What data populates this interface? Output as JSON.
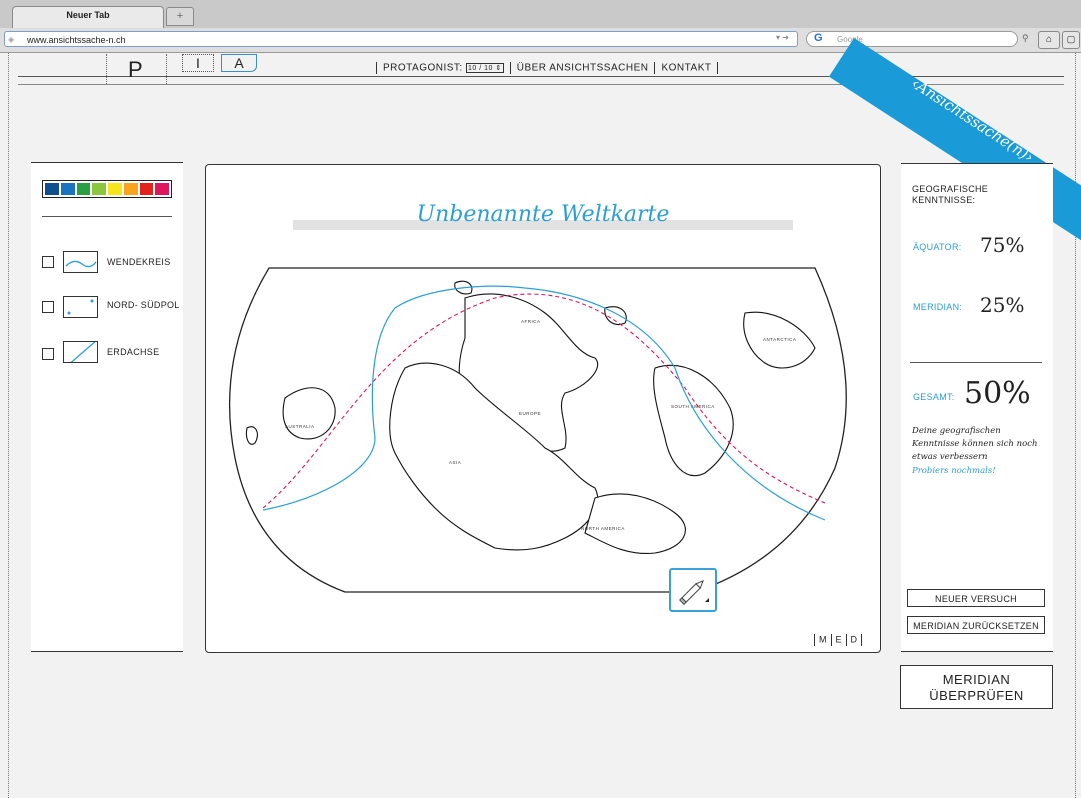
{
  "browser": {
    "tab_title": "Neuer Tab",
    "new_tab_label": "+",
    "url": "www.ansichtssache-n.ch",
    "search_placeholder": "Google",
    "search_engine_glyph": "G"
  },
  "header": {
    "logo_p": "P",
    "logo_i": "I",
    "logo_a": "A",
    "nav": {
      "protagonist_label": "PROTAGONIST:",
      "protagonist_value": "10 / 10",
      "about_label": "ÜBER ANSICHTSSACHEN",
      "contact_label": "KONTAKT"
    },
    "banner_text": "‹Ansichtssache(n)›",
    "banner_color": "#1a9ad6"
  },
  "left_panel": {
    "palette": [
      "#0d4f91",
      "#1a73c0",
      "#2aa043",
      "#8cc63f",
      "#f6e51b",
      "#f7a51c",
      "#e4231f",
      "#e0155e"
    ],
    "legend": [
      {
        "label": "WENDEKREIS",
        "icon": "tropic-line-icon",
        "checked": false
      },
      {
        "label": "NORD- SÜDPOL",
        "icon": "poles-icon",
        "checked": false
      },
      {
        "label": "ERDACHSE",
        "icon": "earth-axis-icon",
        "checked": false
      }
    ]
  },
  "map": {
    "title": "Unbenannte Weltkarte",
    "continents": {
      "africa": "AFRICA",
      "antarctica": "ANTARCTICA",
      "australia": "AUSTRALIA",
      "europe": "EUROPE",
      "south_america": "SOUTH AMERICA",
      "asia": "ASIA",
      "north_america": "NORTH AMERICA"
    },
    "pencil_icon": "pencil-icon",
    "view_modes": [
      "M",
      "E",
      "D"
    ],
    "equator_color": "#e0155e",
    "meridian_color": "#2a9fd6"
  },
  "right_panel": {
    "heading": "GEOGRAFISCHE KENNTNISSE:",
    "equator_label": "ÄQUATOR:",
    "equator_value": "75%",
    "meridian_label": "MERIDIAN:",
    "meridian_value": "25%",
    "total_label": "GESAMT:",
    "total_value": "50%",
    "feedback": "Deine geografischen Kenntnisse können sich noch etwas verbessern",
    "retry_hint": "Probiers nochmals!",
    "new_attempt_button": "NEUER VERSUCH",
    "reset_meridian_button": "MERIDIAN ZURÜCKSETZEN"
  },
  "check_button": "MERIDIAN ÜBERPRÜFEN"
}
